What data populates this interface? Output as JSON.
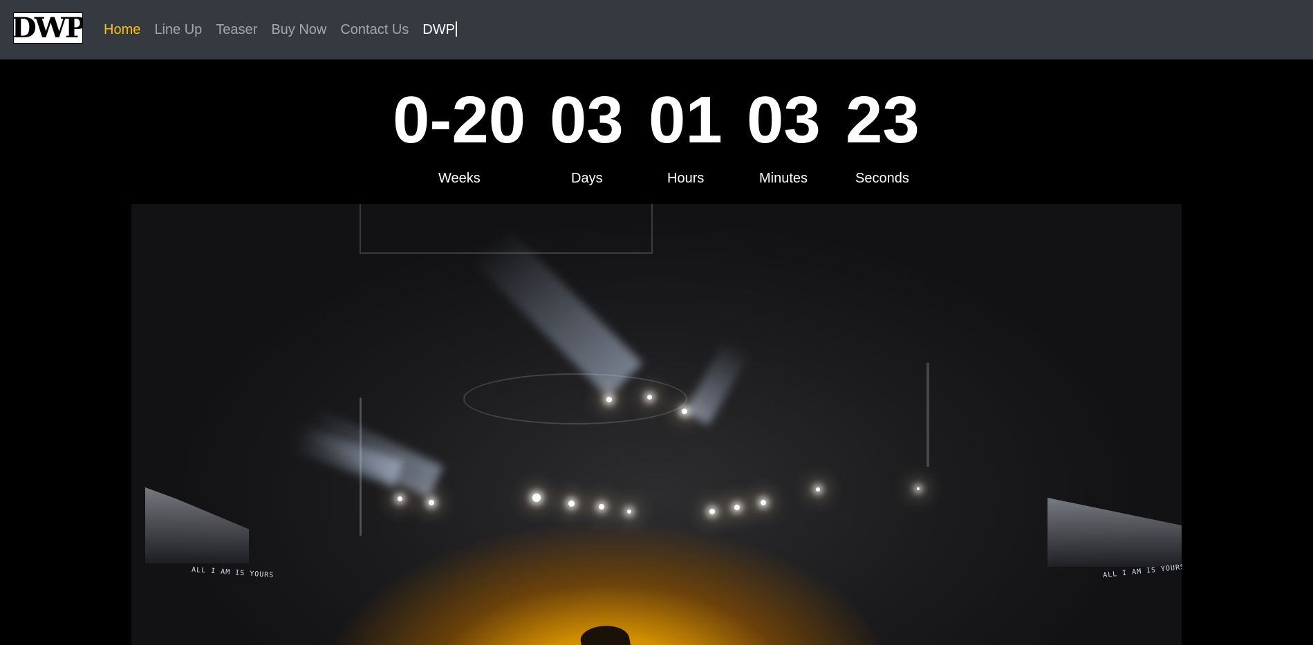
{
  "navbar": {
    "brand_text": "DWP",
    "links": [
      {
        "label": "Home"
      },
      {
        "label": "Line Up"
      },
      {
        "label": "Teaser"
      },
      {
        "label": "Buy Now"
      },
      {
        "label": "Contact Us"
      },
      {
        "label": "DWP"
      }
    ],
    "active_color": "#ffc107",
    "background": "#343a40"
  },
  "countdown": {
    "weeks": {
      "value": "0-20",
      "label": "Weeks"
    },
    "days": {
      "value": "03",
      "label": "Days"
    },
    "hours": {
      "value": "01",
      "label": "Hours"
    },
    "minutes": {
      "value": "03",
      "label": "Minutes"
    },
    "seconds": {
      "value": "23",
      "label": "Seconds"
    }
  },
  "hero": {
    "image": "concert-stage-photo",
    "screen_left_text": "ALL I AM IS YOURS",
    "screen_right_text": "ALL I AM IS YOURS"
  }
}
